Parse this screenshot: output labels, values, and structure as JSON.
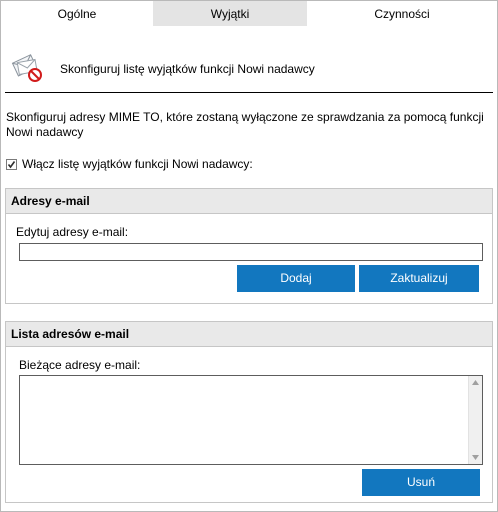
{
  "tabs": [
    {
      "label": "Ogólne"
    },
    {
      "label": "Wyjątki"
    },
    {
      "label": "Czynności"
    }
  ],
  "header": {
    "title": "Skonfiguruj listę wyjątków funkcji Nowi nadawcy",
    "icon": "email-exception-icon"
  },
  "description": "Skonfiguruj adresy MIME TO, które zostaną wyłączone ze sprawdzania za pomocą funkcji Nowi nadawcy",
  "enable_list": {
    "label": "Włącz listę wyjątków funkcji Nowi nadawcy:",
    "checked": true
  },
  "email_group": {
    "title": "Adresy e-mail",
    "field_label": "Edytuj adresy e-mail:",
    "value": "",
    "add_label": "Dodaj",
    "update_label": "Zaktualizuj"
  },
  "list_group": {
    "title": "Lista adresów e-mail",
    "field_label": "Bieżące adresy e-mail:",
    "items": [],
    "remove_label": "Usuń"
  },
  "colors": {
    "button": "#1277bf",
    "active_tab": "#e4e4e4",
    "group_header": "#e9e9e9"
  }
}
